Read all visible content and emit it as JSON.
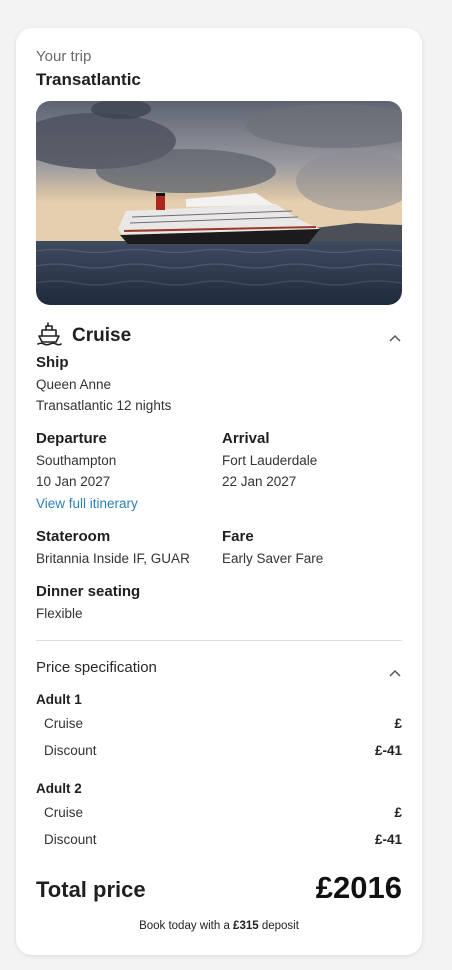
{
  "trip": {
    "overline": "Your trip",
    "title": "Transatlantic"
  },
  "cruise": {
    "section_title": "Cruise",
    "ship_label": "Ship",
    "ship_name": "Queen Anne",
    "ship_voyage": "Transatlantic 12 nights",
    "departure_label": "Departure",
    "departure_port": "Southampton",
    "departure_date": "10 Jan 2027",
    "itinerary_link": "View full itinerary",
    "arrival_label": "Arrival",
    "arrival_port": "Fort Lauderdale",
    "arrival_date": "22 Jan 2027",
    "stateroom_label": "Stateroom",
    "stateroom_value": "Britannia Inside IF, GUAR",
    "fare_label": "Fare",
    "fare_value": "Early Saver Fare",
    "dinner_label": "Dinner seating",
    "dinner_value": "Flexible"
  },
  "price": {
    "section_title": "Price specification",
    "passengers": [
      {
        "name": "Adult 1",
        "lines": [
          {
            "label": "Cruise",
            "value": "£"
          },
          {
            "label": "Discount",
            "value": "£-41"
          }
        ]
      },
      {
        "name": "Adult 2",
        "lines": [
          {
            "label": "Cruise",
            "value": "£"
          },
          {
            "label": "Discount",
            "value": "£-41"
          }
        ]
      }
    ],
    "total_label": "Total price",
    "total_value": "£2016",
    "deposit_prefix": "Book today with a",
    "deposit_amount": "£315",
    "deposit_suffix": "deposit"
  },
  "icons": {
    "cruise": "ship-icon",
    "collapse": "chevron-up-icon"
  },
  "colors": {
    "link": "#2f7fb8",
    "card": "#ffffff",
    "background": "#f3f3f3"
  }
}
